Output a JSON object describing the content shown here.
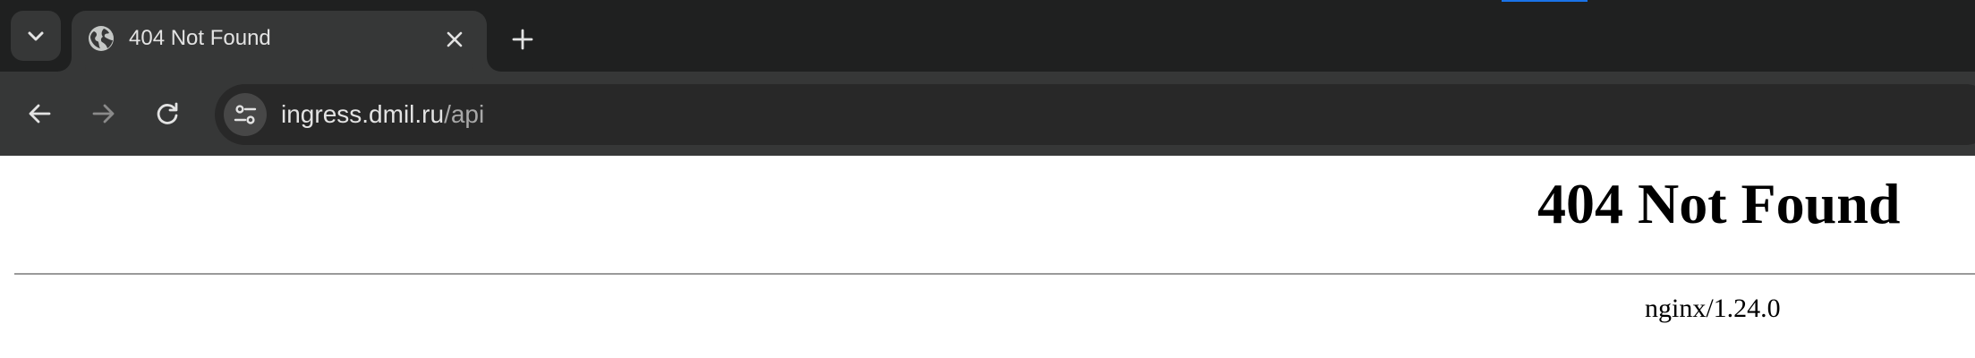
{
  "browser": {
    "tab_search_icon": "chevron-down-icon",
    "tabs": [
      {
        "title": "404 Not Found",
        "favicon": "globe-icon",
        "close_icon": "close-icon",
        "active": true
      }
    ],
    "new_tab_icon": "plus-icon",
    "toolbar": {
      "back_icon": "arrow-left-icon",
      "forward_icon": "arrow-right-icon",
      "reload_icon": "reload-icon",
      "site_info_icon": "tune-icon"
    },
    "address_bar": {
      "host": "ingress.dmil.ru",
      "path": "/api"
    }
  },
  "page": {
    "heading": "404 Not Found",
    "footer": "nginx/1.24.0"
  },
  "colors": {
    "tabstrip_bg": "#1f2020",
    "toolbar_bg": "#363737",
    "omnibox_bg": "#282828",
    "text_primary": "#e3e3e3",
    "text_muted": "#a8a8a8",
    "accent": "#1a73e8",
    "page_bg": "#ffffff"
  }
}
